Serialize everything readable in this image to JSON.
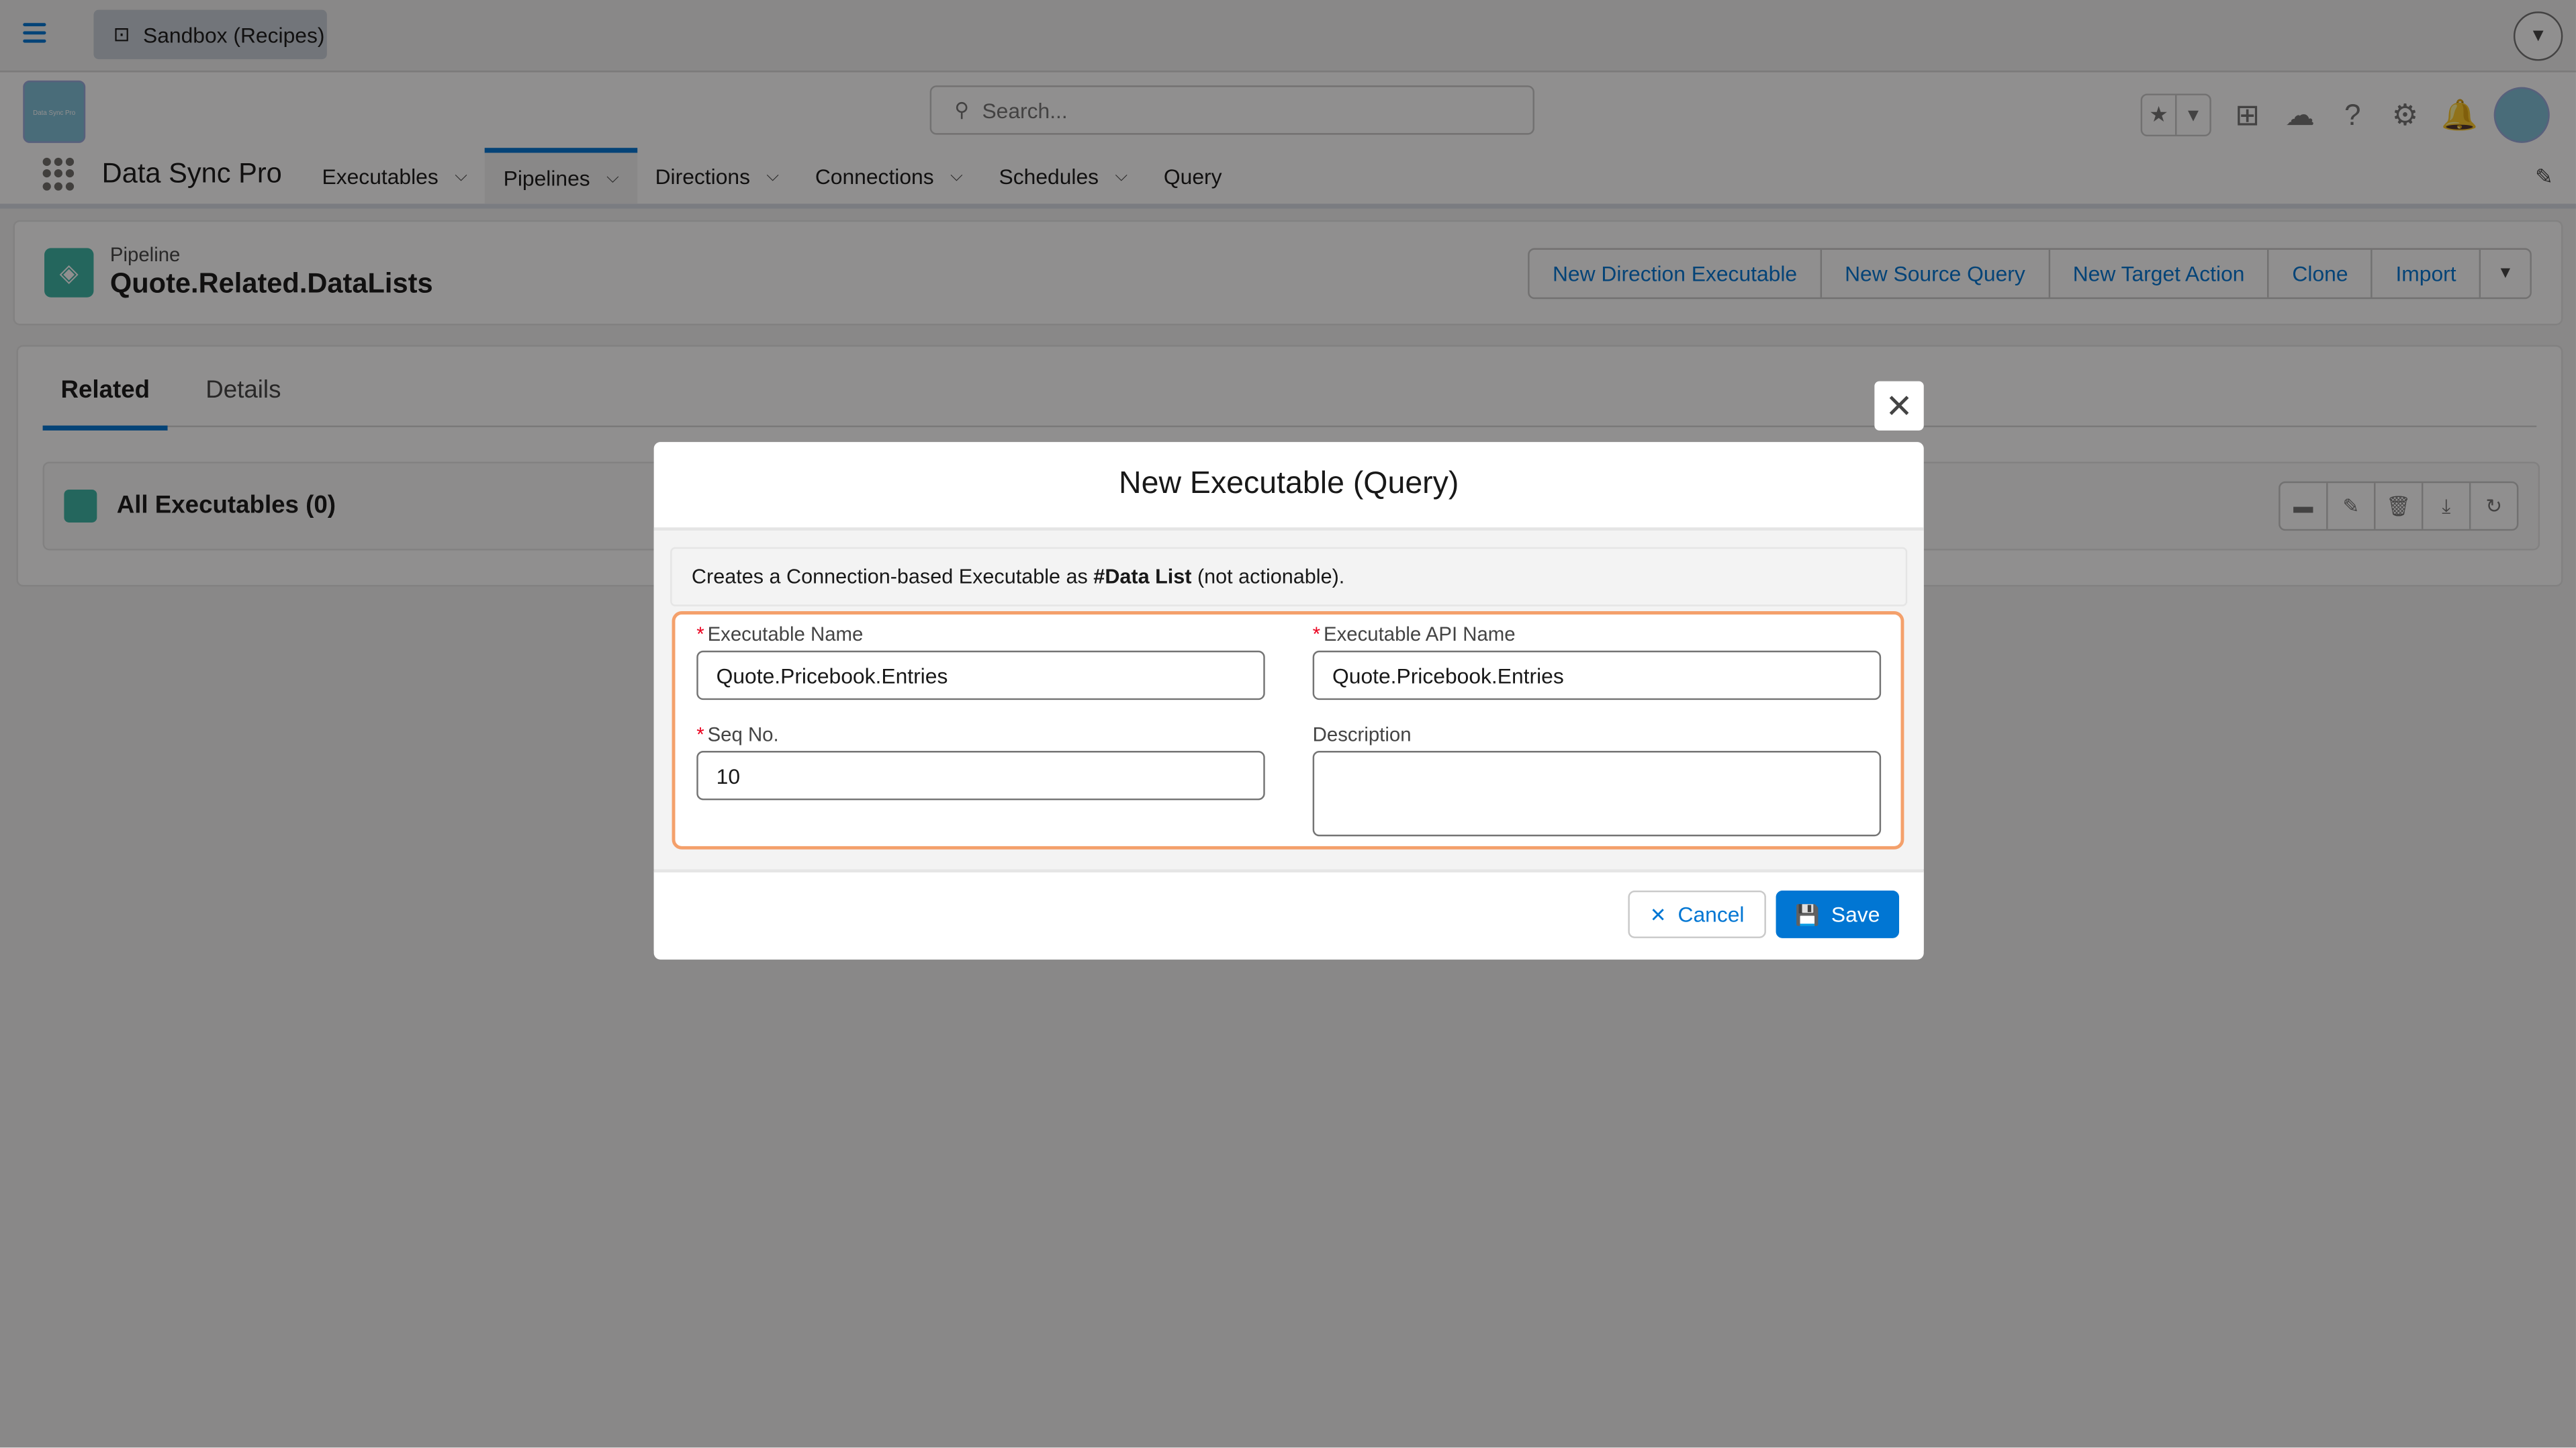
{
  "topbar": {
    "sandbox_label": "Sandbox (Recipes)"
  },
  "header": {
    "search_placeholder": "Search...",
    "logo_text": "Data Sync Pro"
  },
  "nav": {
    "app_name": "Data Sync Pro",
    "items": [
      {
        "label": "Executables"
      },
      {
        "label": "Pipelines"
      },
      {
        "label": "Directions"
      },
      {
        "label": "Connections"
      },
      {
        "label": "Schedules"
      },
      {
        "label": "Query"
      }
    ]
  },
  "record": {
    "type": "Pipeline",
    "name": "Quote.Related.DataLists",
    "actions": [
      "New Direction Executable",
      "New Source Query",
      "New Target Action",
      "Clone",
      "Import"
    ]
  },
  "tabs": [
    "Related",
    "Details"
  ],
  "related_list": {
    "title": "All Executables (0)"
  },
  "modal": {
    "title": "New Executable (Query)",
    "info_prefix": "Creates a Connection-based Executable as ",
    "info_bold": "#Data List",
    "info_suffix": " (not actionable).",
    "fields": {
      "exec_name": {
        "label": "Executable Name",
        "value": "Quote.Pricebook.Entries"
      },
      "api_name": {
        "label": "Executable API Name",
        "value": "Quote.Pricebook.Entries"
      },
      "seq": {
        "label": "Seq No.",
        "value": "10"
      },
      "description": {
        "label": "Description",
        "value": ""
      }
    },
    "cancel_label": "Cancel",
    "save_label": "Save"
  },
  "colors": {
    "brand": "#0176d3",
    "highlight_border": "#f4a06b",
    "record_icon": "#3bb5a5"
  }
}
